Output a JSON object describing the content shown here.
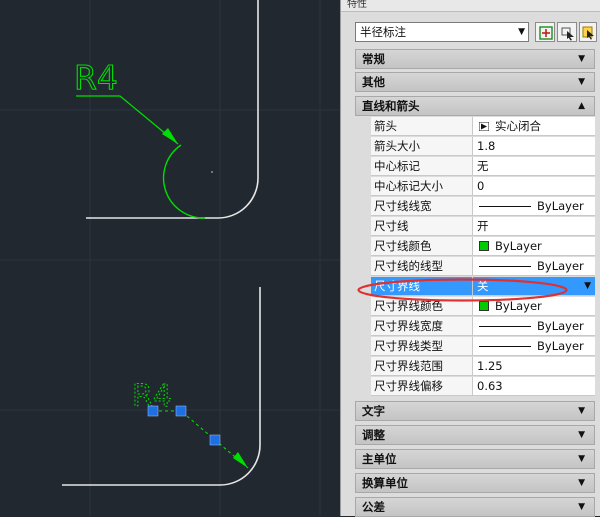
{
  "palette": {
    "title": "特性",
    "selector": {
      "value": "半径标注"
    },
    "categories_top": [
      {
        "label": "常规",
        "state": "collapsed"
      },
      {
        "label": "其他",
        "state": "collapsed"
      },
      {
        "label": "直线和箭头",
        "state": "expanded"
      }
    ],
    "properties": [
      {
        "name": "箭头",
        "value": "实心闭合",
        "kind": "arrow"
      },
      {
        "name": "箭头大小",
        "value": "1.8",
        "kind": "text"
      },
      {
        "name": "中心标记",
        "value": "无",
        "kind": "text"
      },
      {
        "name": "中心标记大小",
        "value": "0",
        "kind": "text"
      },
      {
        "name": "尺寸线线宽",
        "value": "ByLayer",
        "kind": "line"
      },
      {
        "name": "尺寸线",
        "value": "开",
        "kind": "text"
      },
      {
        "name": "尺寸线颜色",
        "value": "ByLayer",
        "kind": "color"
      },
      {
        "name": "尺寸线的线型",
        "value": "ByLayer",
        "kind": "line"
      },
      {
        "name": "尺寸界线",
        "value": "关",
        "kind": "select",
        "selected": true
      },
      {
        "name": "尺寸界线颜色",
        "value": "ByLayer",
        "kind": "color"
      },
      {
        "name": "尺寸界线宽度",
        "value": "ByLayer",
        "kind": "line"
      },
      {
        "name": "尺寸界线类型",
        "value": "ByLayer",
        "kind": "line"
      },
      {
        "name": "尺寸界线范围",
        "value": "1.25",
        "kind": "text"
      },
      {
        "name": "尺寸界线偏移",
        "value": "0.63",
        "kind": "text"
      }
    ],
    "categories_bottom": [
      {
        "label": "文字",
        "state": "collapsed"
      },
      {
        "label": "调整",
        "state": "collapsed"
      },
      {
        "label": "主单位",
        "state": "collapsed"
      },
      {
        "label": "换算单位",
        "state": "collapsed"
      },
      {
        "label": "公差",
        "state": "collapsed"
      }
    ],
    "toolbar_icons": [
      "quick-select-icon",
      "select-objects-icon",
      "toggle-pickadd-icon"
    ]
  },
  "canvas": {
    "dimension_text_top": "R4",
    "dimension_text_bottom": "R4",
    "colors": {
      "background": "#212830",
      "dimension": "#00dd00",
      "geometry": "#e6e6e6",
      "grip": "#1e6fe0",
      "highlight": "#e03030",
      "selection": "#3399ff"
    }
  }
}
